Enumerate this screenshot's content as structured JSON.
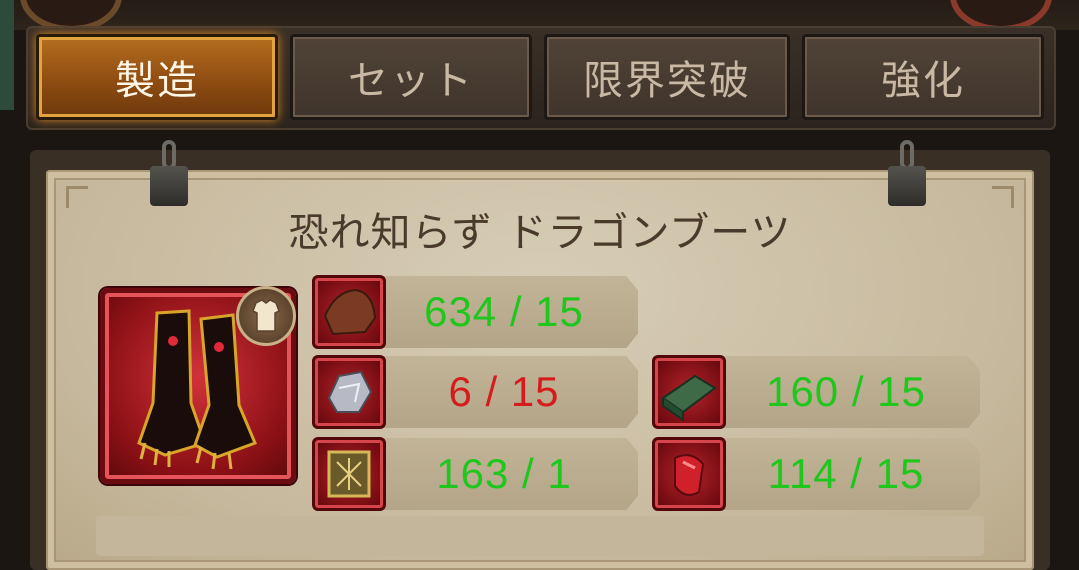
{
  "tabs": [
    {
      "label": "製造",
      "active": true
    },
    {
      "label": "セット",
      "active": false
    },
    {
      "label": "限界突破",
      "active": false
    },
    {
      "label": "強化",
      "active": false
    }
  ],
  "item": {
    "name": "恐れ知らず ドラゴンブーツ",
    "icon": "dragon-boots-icon",
    "badge_icon": "armor-slot-icon"
  },
  "materials": [
    {
      "icon": "leather-icon",
      "count": "634 / 15",
      "sufficient": true
    },
    {
      "icon": "ore-icon",
      "count": "6 / 15",
      "sufficient": false
    },
    {
      "icon": "ingot-icon",
      "count": "160 / 15",
      "sufficient": true
    },
    {
      "icon": "scroll-icon",
      "count": "163 / 1",
      "sufficient": true
    },
    {
      "icon": "red-gem-icon",
      "count": "114 / 15",
      "sufficient": true
    }
  ],
  "colors": {
    "sufficient": "#1fc61c",
    "insufficient": "#d41c1c",
    "active_tab": "#b56e1f"
  }
}
